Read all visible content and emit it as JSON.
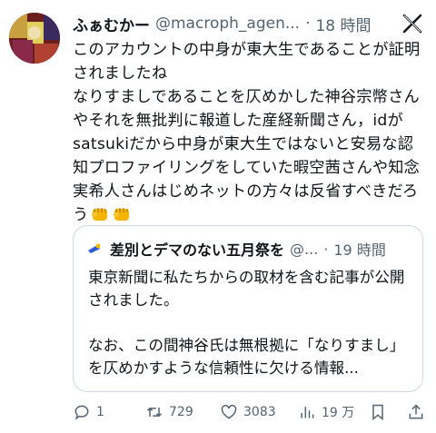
{
  "post": {
    "author_name": "ふぁむかー",
    "handle": "@macroph_agen...",
    "separator": "·",
    "time": "18 時間",
    "body": "このアカウントの中身が東大生であることが証明されましたね\nなりすましであることを仄めかした神谷宗幣さんやそれを無批判に報道した産経新聞さん，idがsatsukiだから中身が東大生ではないと安易な認知プロファイリングをしていた暇空茜さんや知念実希人さんはじめネットの方々は反省すべきだろう",
    "emojis": [
      "fist-emoji",
      "fist-emoji"
    ]
  },
  "quote": {
    "author_name": "差別とデマのない五月祭を",
    "handle": "@...",
    "separator": "·",
    "time": "19 時間",
    "body": "東京新聞に私たちからの取材を含む記事が公開されました。\n\nなお、この間神谷氏は無根拠に「なりすまし」を仄めかすような信頼性に欠ける情報..."
  },
  "actions": {
    "reply_count": "1",
    "repost_count": "729",
    "like_count": "3083",
    "view_count": "19 万"
  },
  "colors": {
    "text": "#0f1419",
    "secondary": "#536471",
    "border": "#cfd9de"
  },
  "icons": [
    "reply-icon",
    "repost-icon",
    "like-icon",
    "views-icon",
    "bookmark-icon",
    "share-icon",
    "x-logo-icon"
  ]
}
